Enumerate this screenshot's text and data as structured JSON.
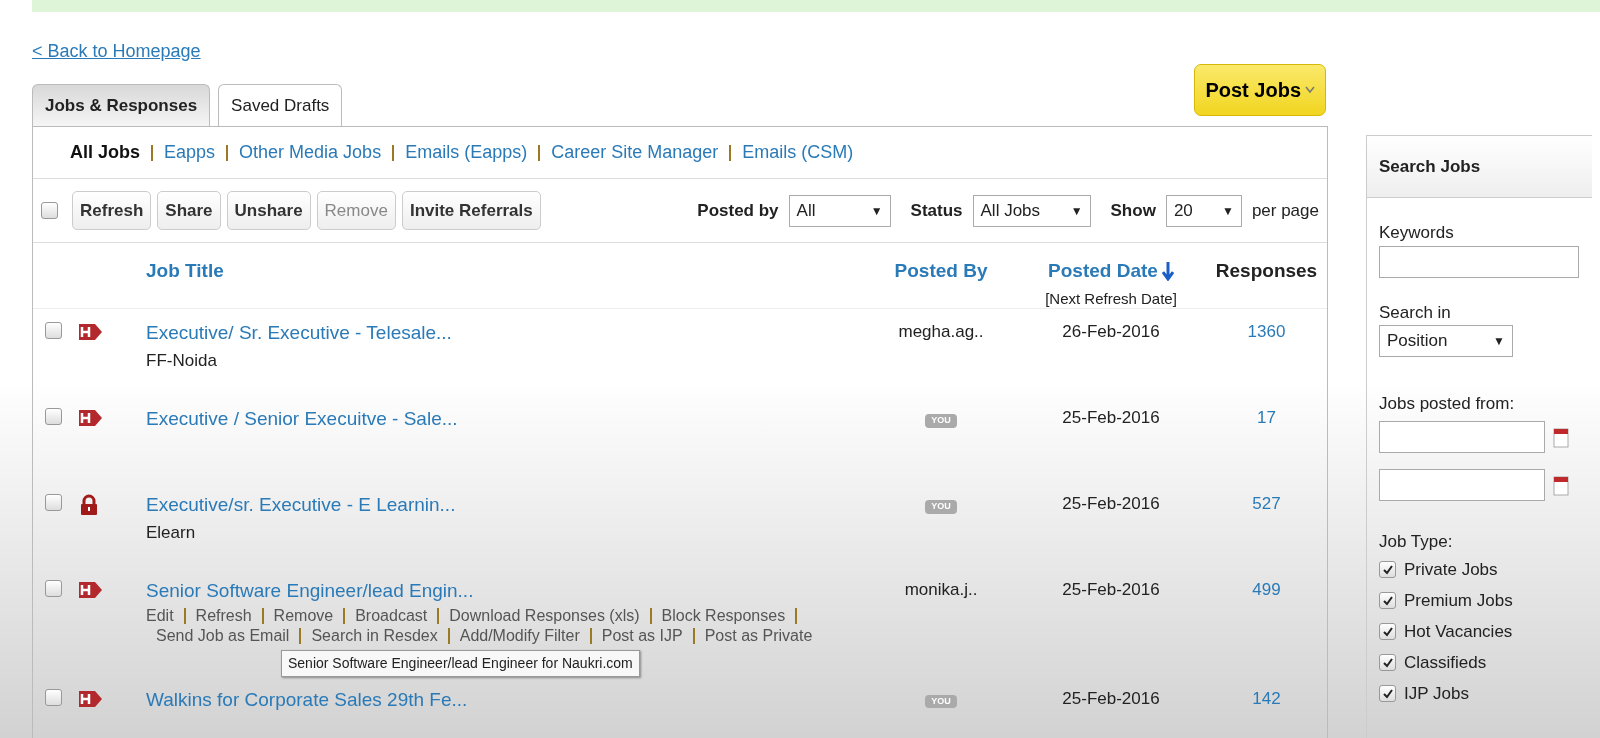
{
  "back_link": "< Back to Homepage",
  "tabs": [
    {
      "label": "Jobs & Responses",
      "selected": true
    },
    {
      "label": "Saved Drafts",
      "selected": false
    }
  ],
  "post_button": {
    "label": "Post Jobs"
  },
  "sub_nav": [
    {
      "label": "All Jobs",
      "selected": true
    },
    {
      "label": "Eapps",
      "selected": false
    },
    {
      "label": "Other Media Jobs",
      "selected": false
    },
    {
      "label": "Emails (Eapps)",
      "selected": false
    },
    {
      "label": "Career Site Manager",
      "selected": false
    },
    {
      "label": "Emails (CSM)",
      "selected": false
    }
  ],
  "toolbar": {
    "select_all_checked": false,
    "buttons": [
      {
        "label": "Refresh",
        "disabled": false
      },
      {
        "label": "Share",
        "disabled": false
      },
      {
        "label": "Unshare",
        "disabled": false
      },
      {
        "label": "Remove",
        "disabled": true
      },
      {
        "label": "Invite Referrals",
        "disabled": false
      }
    ],
    "filters": [
      {
        "label": "Posted by",
        "value": "All",
        "caret": "▼"
      },
      {
        "label": "Status",
        "value": "All Jobs",
        "caret": "▼"
      },
      {
        "label": "Show",
        "value": "20",
        "caret": "▼"
      }
    ],
    "suffix": "per page"
  },
  "table": {
    "columns": [
      {
        "label": "Job Title",
        "kind": "link"
      },
      {
        "label": "Posted By",
        "kind": "link"
      },
      {
        "label": "Posted Date",
        "kind": "sorted",
        "note": "[Next Refresh Date]"
      },
      {
        "label": "Responses",
        "kind": "plain"
      }
    ],
    "rows": [
      {
        "checked": false,
        "kind": "hot",
        "title": "Executive/ Sr. Executive - Telesale...",
        "subtitle": "FF-Noida",
        "posted_by": {
          "kind": "text",
          "text": "megha.ag.."
        },
        "date": "26-Feb-2016",
        "responses": "1360"
      },
      {
        "checked": false,
        "kind": "hot",
        "title": "Executive / Senior Execuitve - Sale...",
        "posted_by": {
          "kind": "badge",
          "text": "YOU"
        },
        "date": "25-Feb-2016",
        "responses": "17"
      },
      {
        "checked": false,
        "kind": "locked",
        "title": "Executive/sr. Executive - E Learnin...",
        "subtitle": "Elearn",
        "posted_by": {
          "kind": "badge",
          "text": "YOU"
        },
        "date": "25-Feb-2016",
        "responses": "527"
      },
      {
        "checked": false,
        "kind": "hot",
        "title": "Senior Software Engineer/lead Engin...",
        "posted_by": {
          "kind": "text",
          "text": "monika.j.."
        },
        "date": "25-Feb-2016",
        "responses": "499",
        "actions": [
          "Edit",
          "Refresh",
          "Remove",
          "Broadcast",
          "Download Responses (xls)",
          "Block Responses",
          "Send Job as Email",
          "Search in Resdex",
          "Add/Modify Filter",
          "Post as IJP",
          "Post as Private"
        ],
        "tooltip": "Senior Software Engineer/lead Engineer for Naukri.com"
      },
      {
        "checked": false,
        "kind": "hot",
        "title": "Walkins for Corporate Sales 29th Fe...",
        "posted_by": {
          "kind": "badge",
          "text": "YOU"
        },
        "date": "25-Feb-2016",
        "responses": "142"
      }
    ]
  },
  "sidebar": {
    "title": "Search Jobs",
    "keywords_label": "Keywords",
    "search_in_label": "Search in",
    "search_in": {
      "value": "Position",
      "caret": "▼"
    },
    "posted_from_label": "Jobs posted from:",
    "job_type_label": "Job Type:",
    "job_types": [
      {
        "label": "Private Jobs",
        "checked": true
      },
      {
        "label": "Premium Jobs",
        "checked": true
      },
      {
        "label": "Hot Vacancies",
        "checked": true
      },
      {
        "label": "Classifieds",
        "checked": true
      },
      {
        "label": "IJP Jobs",
        "checked": true
      }
    ]
  }
}
